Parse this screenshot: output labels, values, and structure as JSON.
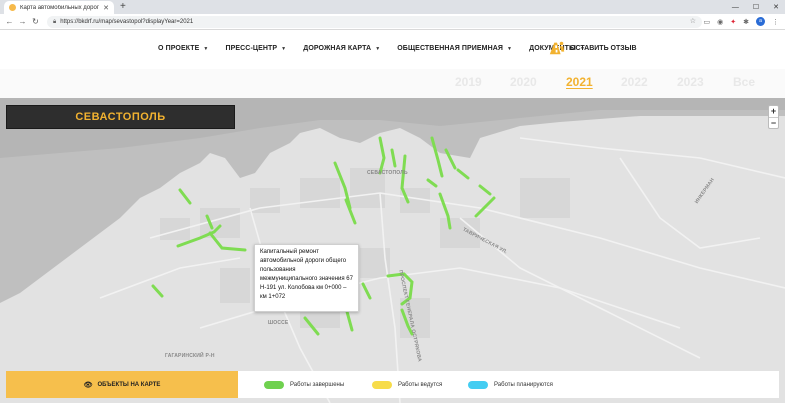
{
  "browser": {
    "tab_title": "Карта автомобильных дорог Се",
    "url": "https://bkdrf.ru/map/sevastopol?displayYear=2021"
  },
  "nav": {
    "items": [
      "О ПРОЕКТЕ",
      "ПРЕСС-ЦЕНТР",
      "ДОРОЖНАЯ КАРТА",
      "ОБЩЕСТВЕННАЯ ПРИЕМНАЯ",
      "ДОКУМЕНТЫ"
    ],
    "feedback": "ОСТАВИТЬ ОТЗЫВ"
  },
  "years": {
    "items": [
      "2019",
      "2020",
      "2021",
      "2022",
      "2023",
      "Все"
    ],
    "active": "2021"
  },
  "map": {
    "city": "СЕВАСТОПОЛЬ",
    "zoom_in": "+",
    "zoom_out": "−",
    "popup_text": "Капитальный ремонт автомобильной дороги общего пользования межмуниципального значения 67 Н-191 ул. Колобова км 0+000 – км 1+072",
    "labels": [
      "СЕВАСТОПОЛЬ",
      "ТАВРИЧЕСКАЯ УЛ.",
      "ПРОСПЕКТ ГЕНЕРАЛА ОСТРЯКОВА",
      "ГАГАРИНСКИЙ Р-Н",
      "ШОССЕ",
      "ИНКЕРМАН"
    ]
  },
  "bottom": {
    "objects_button": "ОБЪЕКТЫ НА КАРТЕ",
    "legend": [
      {
        "label": "Работы завершены",
        "color": "#6fd14f"
      },
      {
        "label": "Работы ведутся",
        "color": "#f7dc4a"
      },
      {
        "label": "Работы планируются",
        "color": "#44cdf2"
      }
    ]
  },
  "colors": {
    "accent": "#f2b230",
    "road_done": "#7fdc52"
  }
}
